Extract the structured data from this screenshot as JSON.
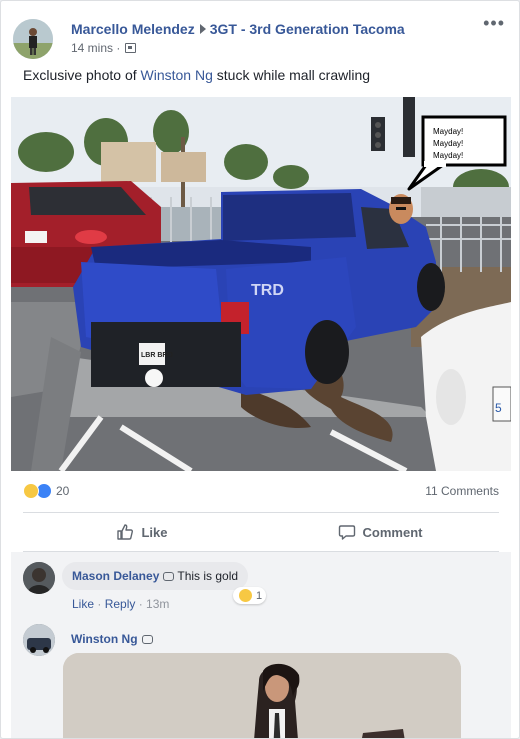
{
  "post": {
    "author": "Marcello Melendez",
    "group": "3GT - 3rd Generation Tacoma",
    "time": "14 mins",
    "separator": "·",
    "more": "•••",
    "text_before": "Exclusive photo of ",
    "mention": "Winston Ng",
    "text_after": " stuck while mall crawling",
    "photo_speech": [
      "Mayday!",
      "Mayday!",
      "Mayday!"
    ]
  },
  "stats": {
    "reaction_count": "20",
    "comments": "11 Comments"
  },
  "actions": {
    "like": "Like",
    "comment": "Comment"
  },
  "comments": [
    {
      "name": "Mason Delaney",
      "text": "This is gold",
      "like": "Like",
      "reply": "Reply",
      "time": "13m",
      "reaction_count": "1"
    },
    {
      "name": "Winston Ng"
    }
  ],
  "icons": [
    "more-options-icon",
    "privacy-icon",
    "haha-reaction-icon",
    "like-reaction-icon",
    "like-icon",
    "comment-icon",
    "chat-icon"
  ],
  "colors": {
    "link": "#385898",
    "secondary": "#606770",
    "accent": "#1877f2"
  }
}
